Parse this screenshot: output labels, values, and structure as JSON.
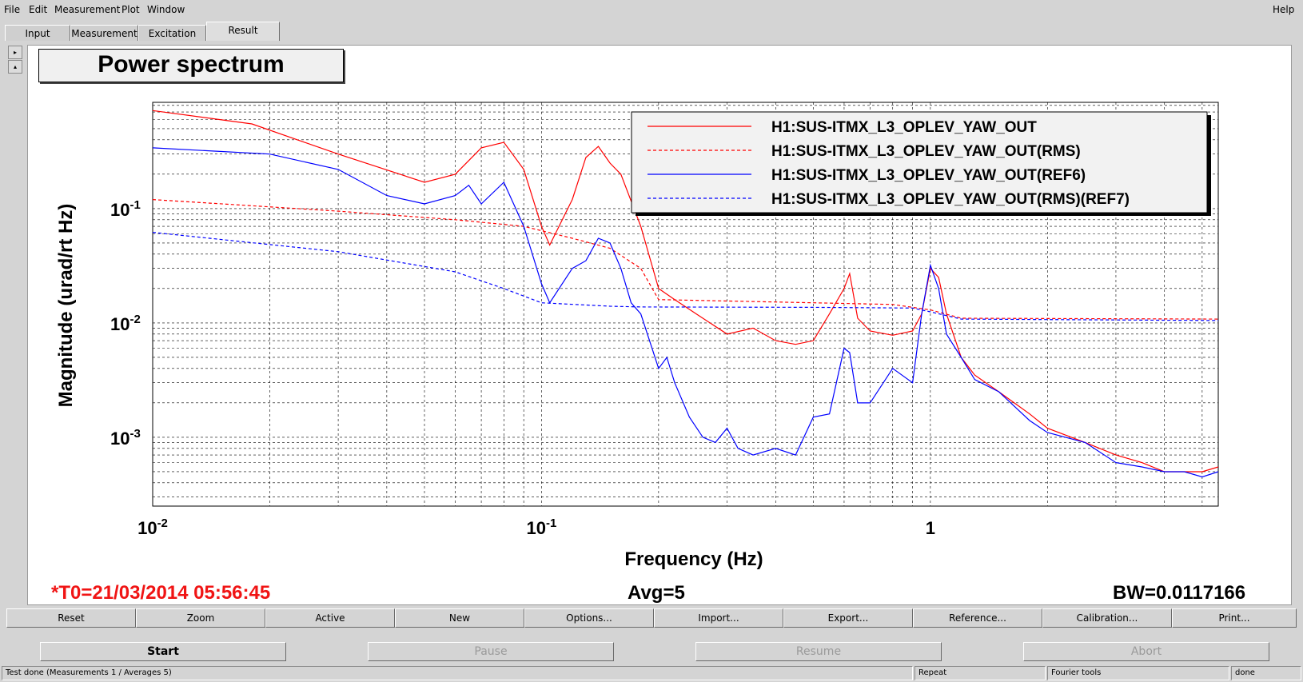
{
  "menu": {
    "file": "File",
    "edit": "Edit",
    "measurement": "Measurement",
    "plot": "Plot",
    "window": "Window",
    "help": "Help"
  },
  "tabs": [
    {
      "label": "Input"
    },
    {
      "label": "Measurement"
    },
    {
      "label": "Excitation"
    },
    {
      "label": "Result"
    }
  ],
  "spinner": {
    "up": "▸",
    "down": "▴"
  },
  "plot_title": "Power spectrum",
  "info": {
    "t0": "*T0=21/03/2014 05:56:45",
    "avg": "Avg=5",
    "bw": "BW=0.0117166"
  },
  "toolbar": [
    "Reset",
    "Zoom",
    "Active",
    "New",
    "Options...",
    "Import...",
    "Export...",
    "Reference...",
    "Calibration...",
    "Print..."
  ],
  "controls": {
    "start": "Start",
    "pause": "Pause",
    "resume": "Resume",
    "abort": "Abort"
  },
  "status": {
    "message": "Test done (Measurements 1 / Averages 5)",
    "repeat": "Repeat",
    "fourier": "Fourier tools",
    "state": "done"
  },
  "colors": {
    "red": "#ff0000",
    "blue": "#0000ff",
    "t0": "#f01414"
  },
  "chart_data": {
    "type": "line",
    "x_scale": "log",
    "y_scale": "log",
    "xlim": [
      0.01,
      5.5
    ],
    "ylim": [
      0.00025,
      0.85
    ],
    "xlabel": "Frequency (Hz)",
    "ylabel": "Magnitude (urad/rt Hz)",
    "x_ticks": [
      {
        "base": "10",
        "exp": "-2",
        "value": 0.01
      },
      {
        "base": "10",
        "exp": "-1",
        "value": 0.1
      },
      {
        "base": "1",
        "exp": "",
        "value": 1
      }
    ],
    "y_ticks": [
      {
        "base": "10",
        "exp": "-1",
        "value": 0.1
      },
      {
        "base": "10",
        "exp": "-2",
        "value": 0.01
      },
      {
        "base": "10",
        "exp": "-3",
        "value": 0.001
      }
    ],
    "grid": true,
    "legend_position": "top-right",
    "series": [
      {
        "name": "H1:SUS-ITMX_L3_OPLEV_YAW_OUT",
        "color": "#ff0000",
        "dash": "solid",
        "points": [
          [
            0.01,
            0.72
          ],
          [
            0.018,
            0.55
          ],
          [
            0.03,
            0.3
          ],
          [
            0.05,
            0.17
          ],
          [
            0.06,
            0.2
          ],
          [
            0.07,
            0.34
          ],
          [
            0.08,
            0.38
          ],
          [
            0.09,
            0.22
          ],
          [
            0.1,
            0.07
          ],
          [
            0.105,
            0.048
          ],
          [
            0.12,
            0.12
          ],
          [
            0.13,
            0.28
          ],
          [
            0.14,
            0.35
          ],
          [
            0.15,
            0.25
          ],
          [
            0.16,
            0.2
          ],
          [
            0.18,
            0.07
          ],
          [
            0.2,
            0.02
          ],
          [
            0.22,
            0.016
          ],
          [
            0.25,
            0.012
          ],
          [
            0.3,
            0.008
          ],
          [
            0.35,
            0.009
          ],
          [
            0.4,
            0.007
          ],
          [
            0.45,
            0.0065
          ],
          [
            0.5,
            0.007
          ],
          [
            0.55,
            0.012
          ],
          [
            0.6,
            0.02
          ],
          [
            0.62,
            0.027
          ],
          [
            0.65,
            0.011
          ],
          [
            0.7,
            0.0085
          ],
          [
            0.8,
            0.0078
          ],
          [
            0.9,
            0.0085
          ],
          [
            0.95,
            0.012
          ],
          [
            1.0,
            0.03
          ],
          [
            1.05,
            0.025
          ],
          [
            1.1,
            0.012
          ],
          [
            1.2,
            0.005
          ],
          [
            1.3,
            0.0035
          ],
          [
            1.5,
            0.0025
          ],
          [
            1.8,
            0.0016
          ],
          [
            2.0,
            0.0012
          ],
          [
            2.5,
            0.0009
          ],
          [
            3.0,
            0.0007
          ],
          [
            3.5,
            0.0006
          ],
          [
            4.0,
            0.0005
          ],
          [
            4.5,
            0.0005
          ],
          [
            5.0,
            0.0005
          ],
          [
            5.5,
            0.00055
          ]
        ]
      },
      {
        "name": "H1:SUS-ITMX_L3_OPLEV_YAW_OUT(RMS)",
        "color": "#ff0000",
        "dash": "dashed",
        "points": [
          [
            0.01,
            0.12
          ],
          [
            0.03,
            0.095
          ],
          [
            0.06,
            0.08
          ],
          [
            0.09,
            0.07
          ],
          [
            0.12,
            0.055
          ],
          [
            0.15,
            0.045
          ],
          [
            0.18,
            0.03
          ],
          [
            0.2,
            0.016
          ],
          [
            0.5,
            0.015
          ],
          [
            0.8,
            0.0145
          ],
          [
            1.0,
            0.013
          ],
          [
            1.2,
            0.011
          ],
          [
            5.5,
            0.0108
          ]
        ]
      },
      {
        "name": "H1:SUS-ITMX_L3_OPLEV_YAW_OUT(REF6)",
        "color": "#0000ff",
        "dash": "solid",
        "points": [
          [
            0.01,
            0.34
          ],
          [
            0.02,
            0.3
          ],
          [
            0.03,
            0.22
          ],
          [
            0.04,
            0.13
          ],
          [
            0.05,
            0.11
          ],
          [
            0.06,
            0.13
          ],
          [
            0.065,
            0.16
          ],
          [
            0.07,
            0.11
          ],
          [
            0.08,
            0.17
          ],
          [
            0.09,
            0.07
          ],
          [
            0.1,
            0.022
          ],
          [
            0.105,
            0.015
          ],
          [
            0.12,
            0.03
          ],
          [
            0.13,
            0.035
          ],
          [
            0.14,
            0.055
          ],
          [
            0.15,
            0.05
          ],
          [
            0.16,
            0.03
          ],
          [
            0.17,
            0.015
          ],
          [
            0.18,
            0.012
          ],
          [
            0.2,
            0.004
          ],
          [
            0.21,
            0.005
          ],
          [
            0.22,
            0.003
          ],
          [
            0.24,
            0.0015
          ],
          [
            0.26,
            0.001
          ],
          [
            0.28,
            0.0009
          ],
          [
            0.3,
            0.0012
          ],
          [
            0.32,
            0.0008
          ],
          [
            0.35,
            0.0007
          ],
          [
            0.4,
            0.0008
          ],
          [
            0.45,
            0.0007
          ],
          [
            0.5,
            0.0015
          ],
          [
            0.55,
            0.0016
          ],
          [
            0.6,
            0.006
          ],
          [
            0.62,
            0.0055
          ],
          [
            0.65,
            0.002
          ],
          [
            0.7,
            0.002
          ],
          [
            0.8,
            0.004
          ],
          [
            0.9,
            0.003
          ],
          [
            0.95,
            0.012
          ],
          [
            1.0,
            0.032
          ],
          [
            1.05,
            0.02
          ],
          [
            1.1,
            0.008
          ],
          [
            1.2,
            0.005
          ],
          [
            1.3,
            0.0032
          ],
          [
            1.5,
            0.0025
          ],
          [
            1.8,
            0.0014
          ],
          [
            2.0,
            0.0011
          ],
          [
            2.5,
            0.0009
          ],
          [
            3.0,
            0.0006
          ],
          [
            3.5,
            0.00055
          ],
          [
            4.0,
            0.0005
          ],
          [
            4.5,
            0.0005
          ],
          [
            5.0,
            0.00045
          ],
          [
            5.5,
            0.0005
          ]
        ]
      },
      {
        "name": "H1:SUS-ITMX_L3_OPLEV_YAW_OUT(RMS)(REF7)",
        "color": "#0000ff",
        "dash": "dashed",
        "points": [
          [
            0.01,
            0.062
          ],
          [
            0.03,
            0.042
          ],
          [
            0.06,
            0.028
          ],
          [
            0.08,
            0.02
          ],
          [
            0.1,
            0.015
          ],
          [
            0.15,
            0.014
          ],
          [
            0.18,
            0.0138
          ],
          [
            0.5,
            0.0137
          ],
          [
            0.9,
            0.0135
          ],
          [
            1.0,
            0.0125
          ],
          [
            1.2,
            0.0108
          ],
          [
            5.5,
            0.0105
          ]
        ]
      }
    ]
  }
}
